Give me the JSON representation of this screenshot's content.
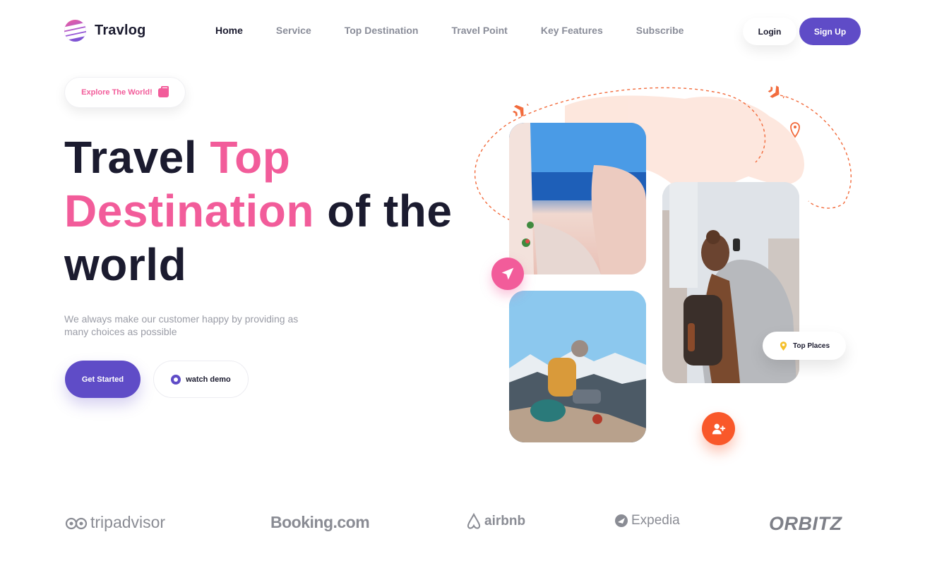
{
  "brand": {
    "name": "Travlog"
  },
  "nav": {
    "items": [
      {
        "label": "Home",
        "active": true
      },
      {
        "label": "Service",
        "active": false
      },
      {
        "label": "Top Destination",
        "active": false
      },
      {
        "label": "Travel Point",
        "active": false
      },
      {
        "label": "Key Features",
        "active": false
      },
      {
        "label": "Subscribe",
        "active": false
      }
    ],
    "login_label": "Login",
    "signup_label": "Sign Up"
  },
  "hero": {
    "badge_label": "Explore The World!",
    "title_part1": "Travel ",
    "title_highlight1": "Top",
    "title_highlight2": "Destination",
    "title_part2": " of the",
    "title_part3": "world",
    "subtitle": "We always make our customer happy by providing as many choices as possible",
    "cta_primary": "Get Started",
    "cta_secondary": "watch demo"
  },
  "gallery": {
    "chip_label": "Top Places"
  },
  "partners": [
    "tripadvisor",
    "Booking.com",
    "airbnb",
    "Expedia",
    "ORBITZ"
  ],
  "colors": {
    "primary": "#5f4cc7",
    "accent_pink": "#f25c9a",
    "accent_orange": "#f9582a",
    "text_dark": "#1b1b2f",
    "text_muted": "#9a9ca6"
  }
}
